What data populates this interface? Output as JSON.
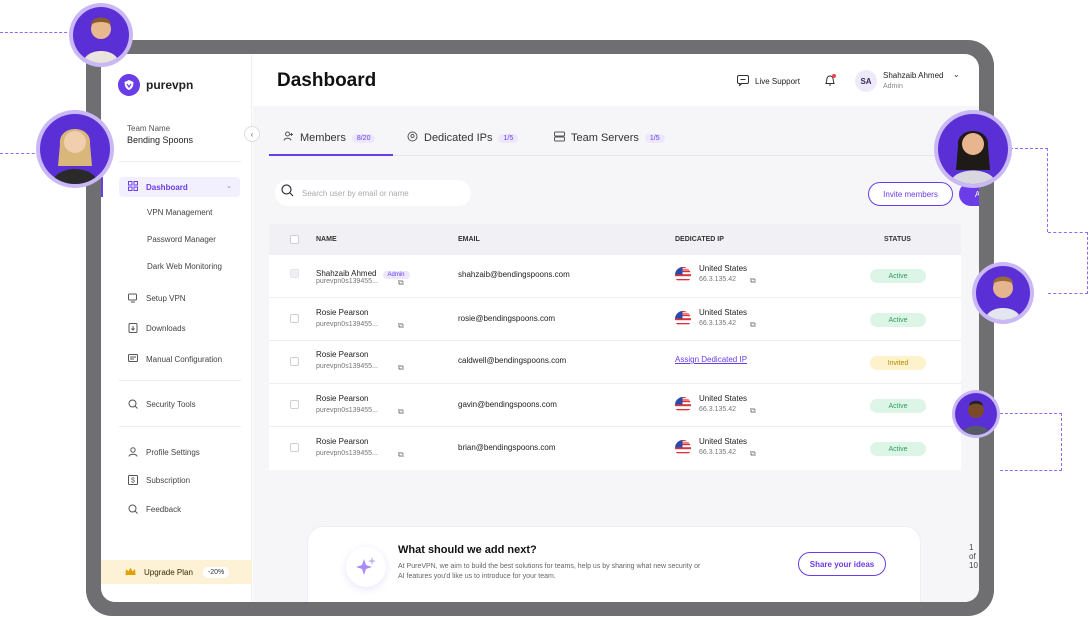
{
  "brand": {
    "name": "purevpn",
    "accent": "#6a3de8"
  },
  "sidebar": {
    "team_label": "Team Name",
    "team_name": "Bending Spoons",
    "dashboard": "Dashboard",
    "sub_items": [
      "VPN Management",
      "Password Manager",
      "Dark Web Monitoring"
    ],
    "items": [
      {
        "label": "Setup VPN",
        "icon": "setup-vpn-icon"
      },
      {
        "label": "Downloads",
        "icon": "download-icon"
      },
      {
        "label": "Manual Configuration",
        "icon": "config-icon"
      },
      {
        "label": "Security Tools",
        "icon": "shield-icon"
      },
      {
        "label": "Profile Settings",
        "icon": "user-icon"
      },
      {
        "label": "Subscription",
        "icon": "dollar-icon"
      },
      {
        "label": "Feedback",
        "icon": "feedback-icon"
      }
    ],
    "upgrade": {
      "label": "Upgrade Plan",
      "discount": "-20%"
    }
  },
  "header": {
    "title": "Dashboard",
    "live_support": "Live Support",
    "user": {
      "initials": "SA",
      "name": "Shahzaib Ahmed",
      "role": "Admin"
    }
  },
  "tabs": [
    {
      "label": "Members",
      "count": "8/20",
      "active": true
    },
    {
      "label": "Dedicated IPs",
      "count": "1/5",
      "active": false
    },
    {
      "label": "Team Servers",
      "count": "1/5",
      "active": false
    }
  ],
  "search": {
    "placeholder": "Search user by email or name"
  },
  "actions": {
    "invite": "Invite members",
    "add": "Add more members"
  },
  "table": {
    "columns": [
      "NAME",
      "EMAIL",
      "DEDICATED IP",
      "STATUS"
    ],
    "rows": [
      {
        "name": "Shahzaib Ahmed",
        "badge": "Admin",
        "id": "purevpn0s139455...",
        "email": "shahzaib@bendingspoons.com",
        "country": "United States",
        "ip": "66.3.135.42",
        "status": "Active"
      },
      {
        "name": "Rosie Pearson",
        "badge": "",
        "id": "purevpn0s139455...",
        "email": "rosie@bendingspoons.com",
        "country": "United States",
        "ip": "66.3.135.42",
        "status": "Active"
      },
      {
        "name": "Rosie Pearson",
        "badge": "",
        "id": "purevpn0s139455...",
        "email": "caldwell@bendingspoons.com",
        "country": "",
        "ip": "",
        "assign": "Assign Dedicated IP",
        "status": "Invited"
      },
      {
        "name": "Rosie Pearson",
        "badge": "",
        "id": "purevpn0s139455...",
        "email": "gavin@bendingspoons.com",
        "country": "United States",
        "ip": "66.3.135.42",
        "status": "Active"
      },
      {
        "name": "Rosie Pearson",
        "badge": "",
        "id": "purevpn0s139455...",
        "email": "brian@bendingspoons.com",
        "country": "United States",
        "ip": "66.3.135.42",
        "status": "Active"
      }
    ]
  },
  "pagination": {
    "text": "1 of 10"
  },
  "feedback": {
    "title": "What should we add next?",
    "text": "At PureVPN, we aim to build the best solutions for teams, help us by sharing what new security or AI features you'd like us to introduce for your team.",
    "button": "Share your ideas"
  },
  "colors": {
    "active_status": "#2d9c5a",
    "invited_status": "#b58a00",
    "upgrade_bg": "#fdf2d6"
  }
}
